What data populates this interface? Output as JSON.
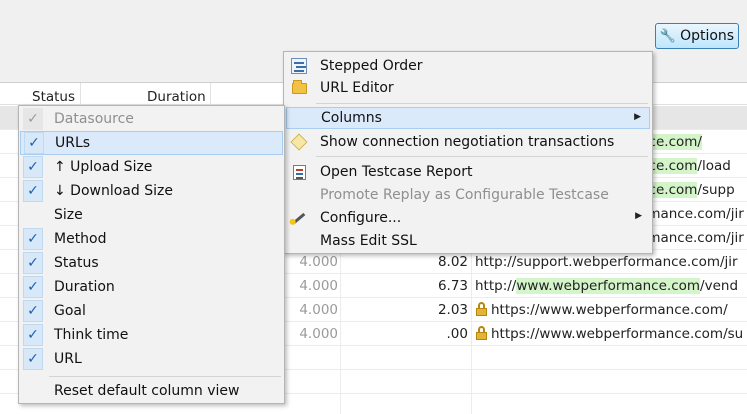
{
  "options_button": {
    "label": "Options"
  },
  "table": {
    "headers": [
      "Status",
      "Duration"
    ],
    "rows": [
      {
        "num1": "",
        "num2": "",
        "url": "",
        "highlight": "",
        "lock": false,
        "selected": true
      },
      {
        "num1": "",
        "num2": "",
        "url_prefix": "",
        "url_hl": "nce.com/",
        "url_suffix": ""
      },
      {
        "num1": "",
        "num2": "",
        "url_prefix": "",
        "url_hl": "nce.com",
        "url_suffix": "/load"
      },
      {
        "num1": "",
        "num2": "",
        "url_prefix": "",
        "url_hl": "nce.com",
        "url_suffix": "/supp"
      },
      {
        "num1": "",
        "num2": "",
        "url_prefix": "",
        "url_hl": "",
        "url_suffix": "rmance.com/jir"
      },
      {
        "num1": "",
        "num2": "",
        "url_prefix": "",
        "url_hl": "",
        "url_suffix": "rmance.com/jir"
      },
      {
        "num1": "4.000",
        "num2": "8.02",
        "url_prefix": "http://support.",
        "url_hl": "",
        "url_suffix": "webperformance.com/jir"
      },
      {
        "num1": "4.000",
        "num2": "6.73",
        "url_prefix": "http://",
        "url_hl": "www.webperformance.com",
        "url_suffix": "/vend"
      },
      {
        "num1": "4.000",
        "num2": "2.03",
        "url_prefix": "",
        "url_hl": "",
        "url_suffix": "https://www.webperformance.com/",
        "lock": true
      },
      {
        "num1": "4.000",
        "num2": ".00",
        "url_prefix": "",
        "url_hl": "",
        "url_suffix": "https://www.webperformance.com/su",
        "lock": true
      }
    ]
  },
  "columns_menu": {
    "items": [
      {
        "label": "Datasource",
        "checked": true,
        "disabled": true
      },
      {
        "label": "URLs",
        "checked": true,
        "hover": true
      },
      {
        "label": "↑ Upload Size",
        "checked": true
      },
      {
        "label": "↓ Download Size",
        "checked": true
      },
      {
        "label": "Size",
        "checked": false
      },
      {
        "label": "Method",
        "checked": true
      },
      {
        "label": "Status",
        "checked": true
      },
      {
        "label": "Duration",
        "checked": true
      },
      {
        "label": "Goal",
        "checked": true
      },
      {
        "label": "Think time",
        "checked": true
      },
      {
        "label": "URL",
        "checked": true
      }
    ],
    "reset_label": "Reset default column view"
  },
  "options_menu": {
    "items": [
      {
        "label": "Stepped Order",
        "icon": "stepped-order-icon"
      },
      {
        "label": "URL Editor",
        "icon": "folder-icon"
      },
      {
        "label": "Columns",
        "icon": "",
        "submenu": true,
        "hover": true
      },
      {
        "label": "Show connection negotiation transactions",
        "icon": "plug-icon"
      },
      {
        "label": "Open Testcase Report",
        "icon": "report-icon"
      },
      {
        "label": "Promote Replay as Configurable Testcase",
        "icon": "",
        "disabled": true
      },
      {
        "label": "Configure...",
        "icon": "wand-icon",
        "submenu": true
      },
      {
        "label": "Mass Edit SSL",
        "icon": ""
      }
    ]
  }
}
